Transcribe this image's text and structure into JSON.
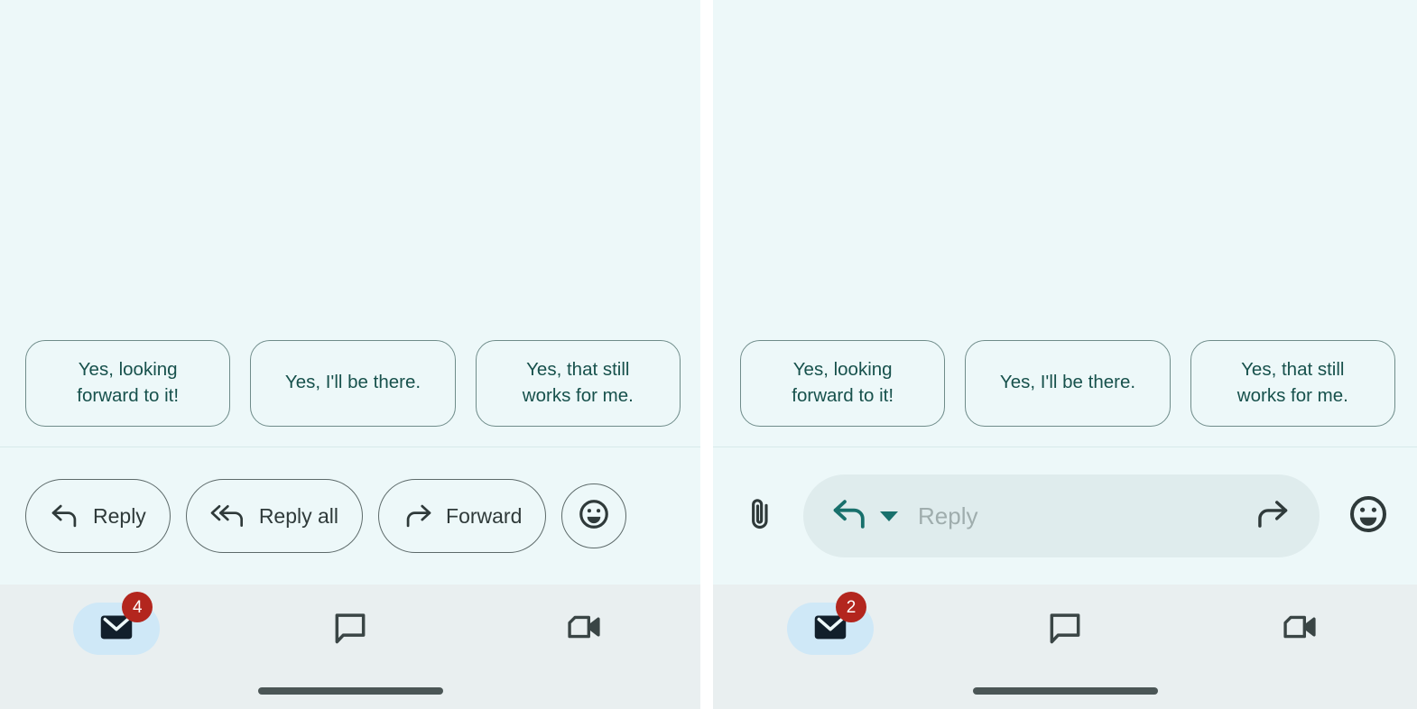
{
  "colors": {
    "panel_bg": "#edf8f9",
    "nav_bg": "#e9eff0",
    "chip_text": "#17514c",
    "chip_border": "#6f8c8a",
    "action_text": "#2f3a3a",
    "badge_bg": "#b3261e",
    "badge_text": "#ffffff",
    "nav_active_pill": "#cfe8f7",
    "mail_icon": "#121f2b",
    "composer_field_bg": "#dfeced",
    "reply_arrow_teal": "#18706c",
    "placeholder_text": "#9fadad",
    "home_indicator": "#4b5656"
  },
  "left_panel": {
    "name": "email-detail-classic-actions",
    "smart_replies": {
      "label": "smart-reply-suggestions",
      "chips": [
        {
          "text": "Yes, looking\nforward to it!"
        },
        {
          "text": "Yes, I'll be there."
        },
        {
          "text": "Yes, that still\nworks for me."
        }
      ]
    },
    "action_bar": {
      "buttons": [
        {
          "label": "Reply",
          "icon": "reply-arrow-icon"
        },
        {
          "label": "Reply all",
          "icon": "reply-all-arrow-icon"
        },
        {
          "label": "Forward",
          "icon": "forward-arrow-icon"
        }
      ],
      "emoji_button_icon": "emoji-smiley-icon"
    },
    "bottom_nav": {
      "items": [
        {
          "icon": "mail-icon",
          "active": true,
          "badge": "4"
        },
        {
          "icon": "chat-bubble-icon",
          "active": false,
          "badge": ""
        },
        {
          "icon": "video-camera-icon",
          "active": false,
          "badge": ""
        }
      ]
    }
  },
  "right_panel": {
    "name": "email-detail-inline-composer",
    "smart_replies": {
      "label": "smart-reply-suggestions",
      "chips": [
        {
          "text": "Yes, looking\nforward to it!"
        },
        {
          "text": "Yes, I'll be there."
        },
        {
          "text": "Yes, that still\nworks for me."
        }
      ]
    },
    "composer": {
      "attach_icon": "paperclip-icon",
      "reply_mode_icon": "reply-arrow-icon",
      "reply_mode_caret_icon": "chevron-down-icon",
      "placeholder": "Reply",
      "value": "",
      "send_icon": "forward-arrow-icon",
      "emoji_icon": "emoji-smiley-icon"
    },
    "bottom_nav": {
      "items": [
        {
          "icon": "mail-icon",
          "active": true,
          "badge": "2"
        },
        {
          "icon": "chat-bubble-icon",
          "active": false,
          "badge": ""
        },
        {
          "icon": "video-camera-icon",
          "active": false,
          "badge": ""
        }
      ]
    }
  }
}
